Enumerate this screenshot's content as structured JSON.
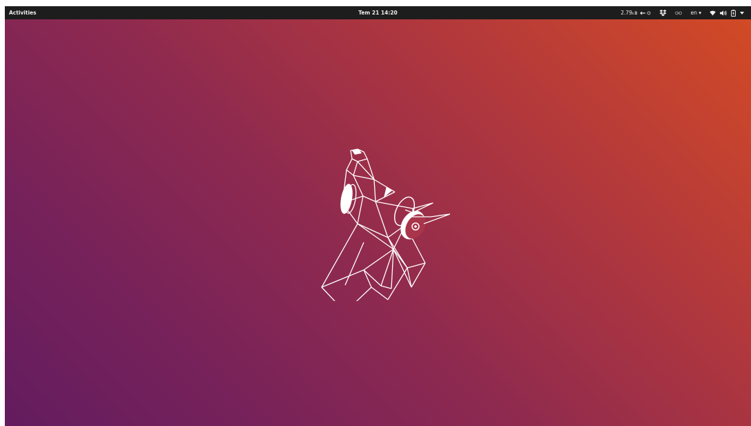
{
  "topbar": {
    "activities_label": "Activities",
    "clock": "Tem 21  14:20",
    "net_speed": "2.79ₖʙ",
    "keyboard_layout": "en ▾"
  },
  "tray_icons": [
    "network-speed-arrows-icon",
    "dropbox-icon",
    "link-icon",
    "keyboard-layout",
    "wifi-icon",
    "volume-icon",
    "battery-icon",
    "system-menu-arrow-icon"
  ],
  "colors": {
    "topbar": "#1d1d1d",
    "wallpaper_top_right": "#d24a25",
    "wallpaper_bottom_left": "#631c5f"
  },
  "wallpaper": {
    "name": "ubuntu-bionic-beaver-wireframe"
  }
}
